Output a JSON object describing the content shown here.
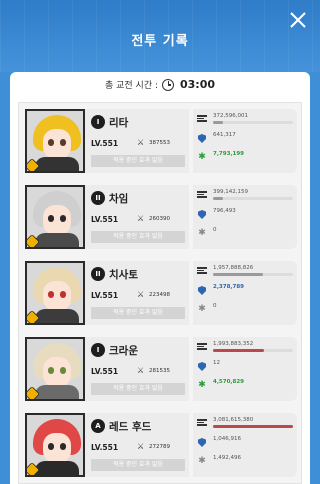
{
  "header": {
    "title": "전투 기록"
  },
  "timer": {
    "label": "총 교전 시간 :",
    "value": "03:00"
  },
  "buff_text": "적용 중인 효과 없음",
  "level_label": "LV.551",
  "colors": {
    "accent_blue": "#3f8fd6",
    "heal_green": "#2a9d3a",
    "dmg_red": "#b84a4a",
    "shield_blue": "#2f66b3"
  },
  "characters": [
    {
      "name": "리타",
      "burst": "I",
      "combat_power": "387553",
      "damage": "372,596,001",
      "taken": "641,317",
      "heal": "7,793,199",
      "damage_fill": 0.12,
      "taken_fill": 0.0,
      "heal_fill": 0.0,
      "damage_red": false,
      "taken_blue": false,
      "heal_green": true
    },
    {
      "name": "차임",
      "burst": "II",
      "combat_power": "260390",
      "damage": "399,142,159",
      "taken": "796,493",
      "heal": "0",
      "damage_fill": 0.13,
      "taken_fill": 0.0,
      "heal_fill": 0.0,
      "damage_red": false,
      "taken_blue": false,
      "heal_green": false
    },
    {
      "name": "치사토",
      "burst": "II",
      "combat_power": "223498",
      "damage": "1,957,888,826",
      "taken": "2,378,789",
      "heal": "0",
      "damage_fill": 0.62,
      "taken_fill": 0.0,
      "heal_fill": 0.0,
      "damage_red": false,
      "taken_blue": true,
      "heal_green": false
    },
    {
      "name": "크라운",
      "burst": "I",
      "combat_power": "281535",
      "damage": "1,993,883,352",
      "taken": "12",
      "heal": "4,570,829",
      "damage_fill": 0.64,
      "taken_fill": 0.0,
      "heal_fill": 0.0,
      "damage_red": true,
      "taken_blue": false,
      "heal_green": true
    },
    {
      "name": "레드 후드",
      "burst": "A",
      "combat_power": "272789",
      "damage": "3,081,615,380",
      "taken": "1,046,916",
      "heal": "1,492,496",
      "damage_fill": 1.0,
      "taken_fill": 0.0,
      "heal_fill": 0.0,
      "damage_red": true,
      "taken_blue": false,
      "heal_green": false
    }
  ]
}
